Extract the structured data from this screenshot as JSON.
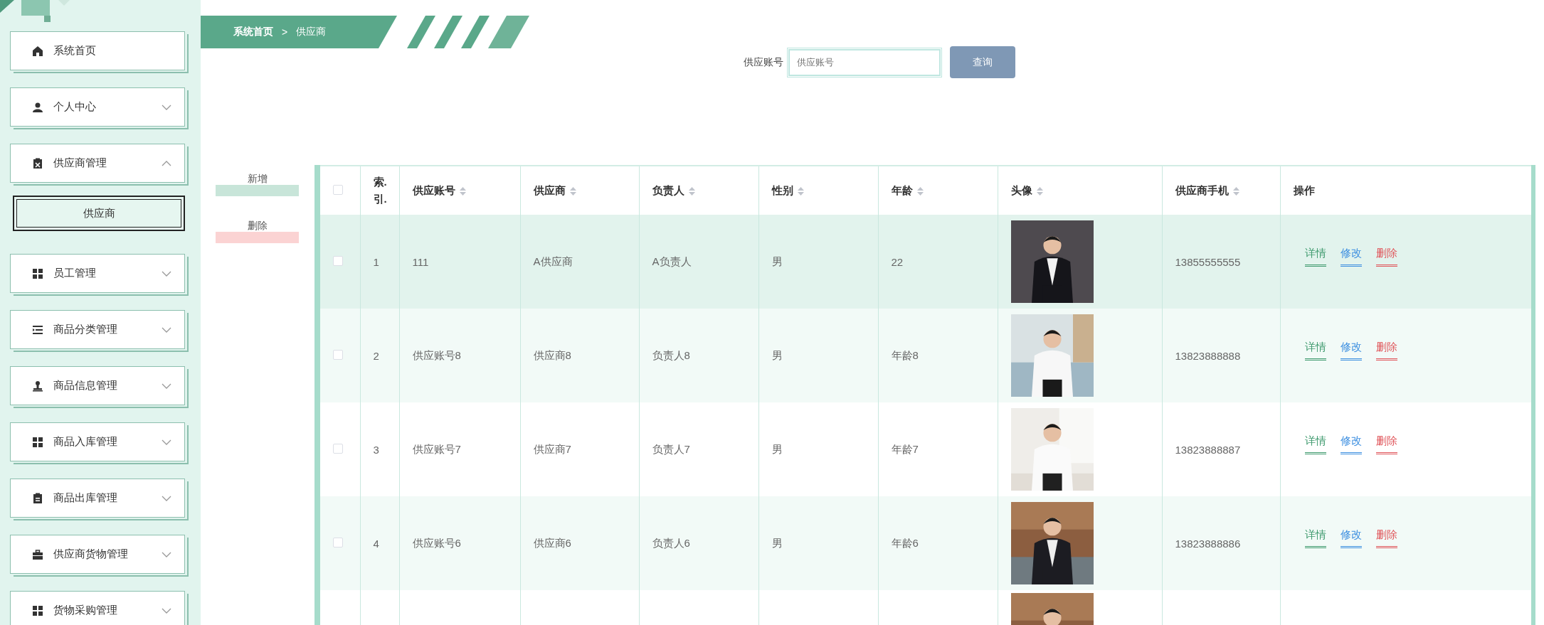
{
  "sidebar": {
    "items": [
      {
        "label": "系统首页",
        "kind": "link"
      },
      {
        "label": "个人中心",
        "kind": "submenu",
        "expanded": false
      },
      {
        "label": "供应商管理",
        "kind": "submenu",
        "expanded": true,
        "children": [
          {
            "label": "供应商",
            "selected": true
          }
        ]
      },
      {
        "label": "员工管理",
        "kind": "submenu",
        "expanded": false
      },
      {
        "label": "商品分类管理",
        "kind": "submenu",
        "expanded": false
      },
      {
        "label": "商品信息管理",
        "kind": "submenu",
        "expanded": false
      },
      {
        "label": "商品入库管理",
        "kind": "submenu",
        "expanded": false
      },
      {
        "label": "商品出库管理",
        "kind": "submenu",
        "expanded": false
      },
      {
        "label": "供应商货物管理",
        "kind": "submenu",
        "expanded": false
      },
      {
        "label": "货物采购管理",
        "kind": "submenu",
        "expanded": false
      }
    ]
  },
  "breadcrumb": {
    "home": "系统首页",
    "separator": ">",
    "current": "供应商"
  },
  "search": {
    "label": "供应账号",
    "placeholder": "供应账号",
    "button": "查询"
  },
  "actions": [
    {
      "label": "新增",
      "kind": "add"
    },
    {
      "label": "删除",
      "kind": "delete"
    }
  ],
  "table": {
    "columns": [
      {
        "kind": "checkbox",
        "checked": false
      },
      {
        "kind": "text",
        "label": "索.引.",
        "sortable": false
      },
      {
        "kind": "text",
        "label": "供应账号",
        "sortable": true
      },
      {
        "kind": "text",
        "label": "供应商",
        "sortable": true
      },
      {
        "kind": "text",
        "label": "负责人",
        "sortable": true
      },
      {
        "kind": "text",
        "label": "性别",
        "sortable": true
      },
      {
        "kind": "text",
        "label": "年龄",
        "sortable": true
      },
      {
        "kind": "text",
        "label": "头像",
        "sortable": true
      },
      {
        "kind": "text",
        "label": "供应商手机",
        "sortable": true
      },
      {
        "kind": "text",
        "label": "操作",
        "sortable": false
      }
    ],
    "rows": [
      {
        "highlighted": true,
        "checked": false,
        "index": "1",
        "account": "111",
        "supplier": "A供应商",
        "contact": "A负责人",
        "gender": "男",
        "age": "22",
        "phone": "13855555555",
        "actions": [
          {
            "label": "详情",
            "kind": "detail"
          },
          {
            "label": "修改",
            "kind": "edit"
          },
          {
            "label": "删除",
            "kind": "delete"
          }
        ]
      },
      {
        "highlighted": false,
        "checked": false,
        "index": "2",
        "account": "供应账号8",
        "supplier": "供应商8",
        "contact": "负责人8",
        "gender": "男",
        "age": "年龄8",
        "phone": "13823888888",
        "actions": [
          {
            "label": "详情",
            "kind": "detail"
          },
          {
            "label": "修改",
            "kind": "edit"
          },
          {
            "label": "删除",
            "kind": "delete"
          }
        ]
      },
      {
        "highlighted": false,
        "checked": false,
        "index": "3",
        "account": "供应账号7",
        "supplier": "供应商7",
        "contact": "负责人7",
        "gender": "男",
        "age": "年龄7",
        "phone": "13823888887",
        "actions": [
          {
            "label": "详情",
            "kind": "detail"
          },
          {
            "label": "修改",
            "kind": "edit"
          },
          {
            "label": "删除",
            "kind": "delete"
          }
        ]
      },
      {
        "highlighted": false,
        "checked": false,
        "index": "4",
        "account": "供应账号6",
        "supplier": "供应商6",
        "contact": "负责人6",
        "gender": "男",
        "age": "年龄6",
        "phone": "13823888886",
        "actions": [
          {
            "label": "详情",
            "kind": "detail"
          },
          {
            "label": "修改",
            "kind": "edit"
          },
          {
            "label": "删除",
            "kind": "delete"
          }
        ]
      },
      {
        "highlighted": false
      }
    ]
  }
}
